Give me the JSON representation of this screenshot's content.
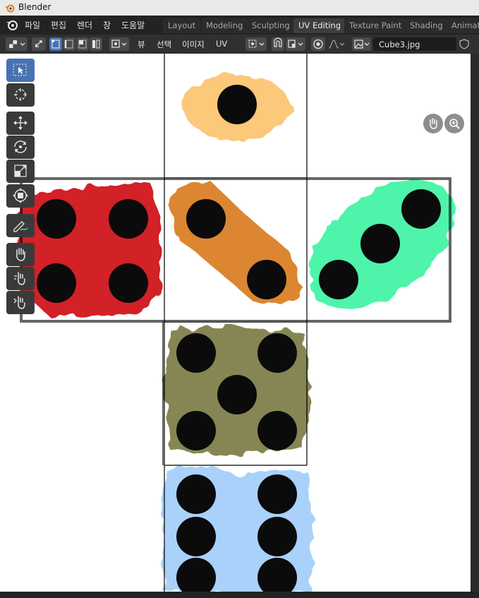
{
  "window": {
    "title": "Blender"
  },
  "menus": [
    "파일",
    "편집",
    "렌더",
    "창",
    "도움말"
  ],
  "workspace_tabs": [
    {
      "label": "Layout",
      "active": false
    },
    {
      "label": "Modeling",
      "active": false
    },
    {
      "label": "Sculpting",
      "active": false
    },
    {
      "label": "UV Editing",
      "active": true
    },
    {
      "label": "Texture Paint",
      "active": false
    },
    {
      "label": "Shading",
      "active": false
    },
    {
      "label": "Animati",
      "active": false
    }
  ],
  "header": {
    "view_menu": "뷰",
    "select_menu": "선택",
    "image_menu": "이미지",
    "uv_menu": "UV",
    "image_name": "Cube3.jpg"
  },
  "tools": [
    {
      "name": "select-box",
      "icon": "select-box-icon",
      "active": true
    },
    {
      "name": "cursor",
      "icon": "cursor-icon",
      "active": false
    },
    {
      "name": "move",
      "icon": "move-icon",
      "active": false
    },
    {
      "name": "rotate",
      "icon": "rotate-icon",
      "active": false
    },
    {
      "name": "scale",
      "icon": "scale-icon",
      "active": false
    },
    {
      "name": "transform",
      "icon": "transform-icon",
      "active": false
    },
    {
      "name": "annotate",
      "icon": "annotate-icon",
      "active": false
    },
    {
      "name": "grab",
      "icon": "grab-icon",
      "active": false
    },
    {
      "name": "relax",
      "icon": "relax-icon",
      "active": false
    },
    {
      "name": "pinch",
      "icon": "pinch-icon",
      "active": false
    }
  ],
  "texture": {
    "faces": [
      {
        "name": "top-face",
        "color": "#fcc36c",
        "pips": 1
      },
      {
        "name": "left-face",
        "color": "#d0131a",
        "pips": 4
      },
      {
        "name": "center-face",
        "color": "#d97a1c",
        "pips": 2
      },
      {
        "name": "right-face",
        "color": "#3af3a0",
        "pips": 3
      },
      {
        "name": "lower-face",
        "color": "#7a7a42",
        "pips": 5
      },
      {
        "name": "bottom-face",
        "color": "#9bc9fa",
        "pips": 6
      }
    ],
    "pip_color": "#0b0b0b",
    "uv_edge_color": "#000000"
  },
  "colors": {
    "accent": "#4772b3"
  }
}
